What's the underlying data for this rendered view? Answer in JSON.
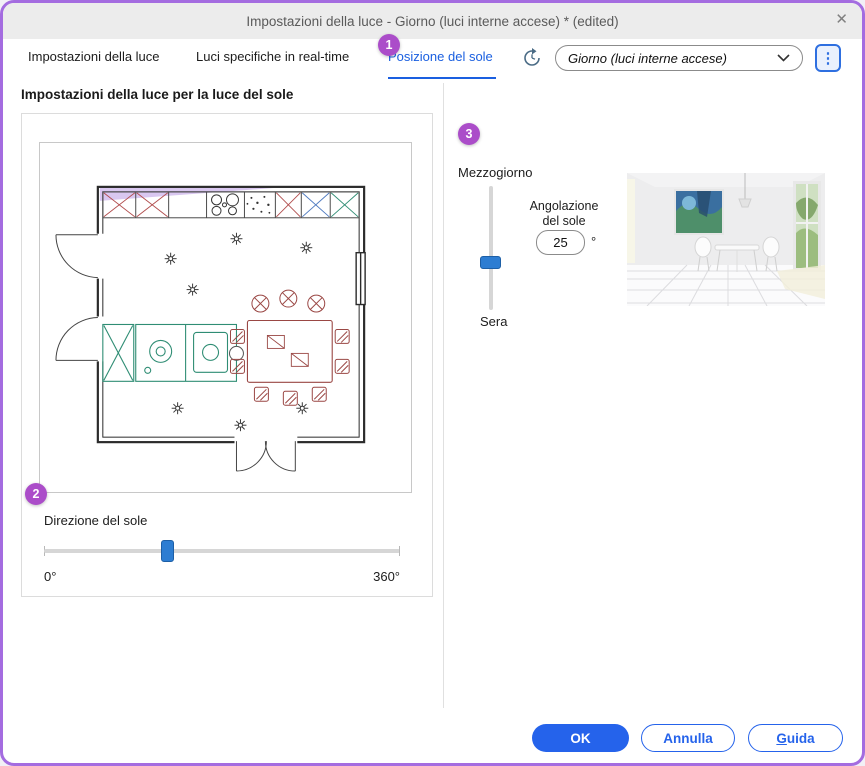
{
  "colors": {
    "window_border_purple": "#a46ce0",
    "badge_purple": "#ab4dc9",
    "accent_blue": "#2563eb",
    "active_tab_blue": "#1a5fe0",
    "slider_blue": "#2d7dd2",
    "titlebar_gray": "#ececec"
  },
  "window": {
    "title": "Impostazioni della luce - Giorno (luci interne accese) * (edited)",
    "close_glyph": "✕"
  },
  "tabs": [
    {
      "label": "Impostazioni della luce"
    },
    {
      "label": "Luci specifiche in real-time"
    },
    {
      "label": "Posizione del sole"
    }
  ],
  "toolbar": {
    "preset_value": "Giorno (luci interne accese)",
    "kebab_glyph": "⋮"
  },
  "badges": {
    "step1": "1",
    "step2": "2",
    "step3": "3"
  },
  "left_panel": {
    "heading": "Impostazioni della luce per la luce del sole",
    "direction_label": "Direzione del sole",
    "range_min": "0°",
    "range_max": "360°"
  },
  "right_panel": {
    "slider_top_label": "Mezzogiorno",
    "slider_bottom_label": "Sera",
    "angle_label_line1": "Angolazione",
    "angle_label_line2": "del sole",
    "angle_value": "25",
    "angle_unit": "°"
  },
  "footer": {
    "ok_label": "OK",
    "cancel_label": "Annulla",
    "help_label": "Guida"
  }
}
